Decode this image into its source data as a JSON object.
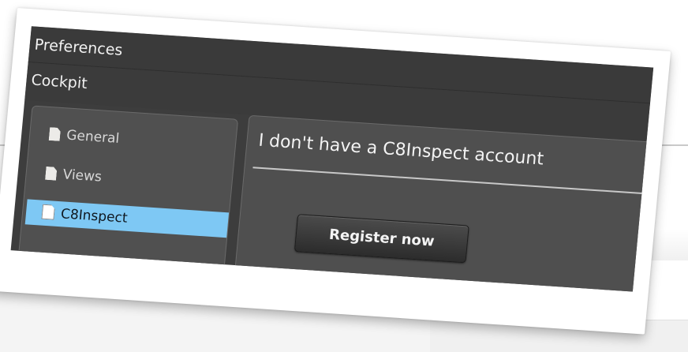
{
  "window": {
    "title": "Preferences",
    "section": "Cockpit"
  },
  "sidebar": {
    "items": [
      {
        "label": "General",
        "icon": "document-icon",
        "selected": false
      },
      {
        "label": "Views",
        "icon": "document-icon",
        "selected": false
      },
      {
        "label": "C8Inspect",
        "icon": "document-icon",
        "selected": true
      }
    ]
  },
  "main": {
    "heading": "I don't have a C8Inspect account",
    "register_button_label": "Register now"
  },
  "colors": {
    "selection": "#7ec8f4",
    "dark_background": "#3d3d3d",
    "panel_background": "#4f4f4f"
  }
}
